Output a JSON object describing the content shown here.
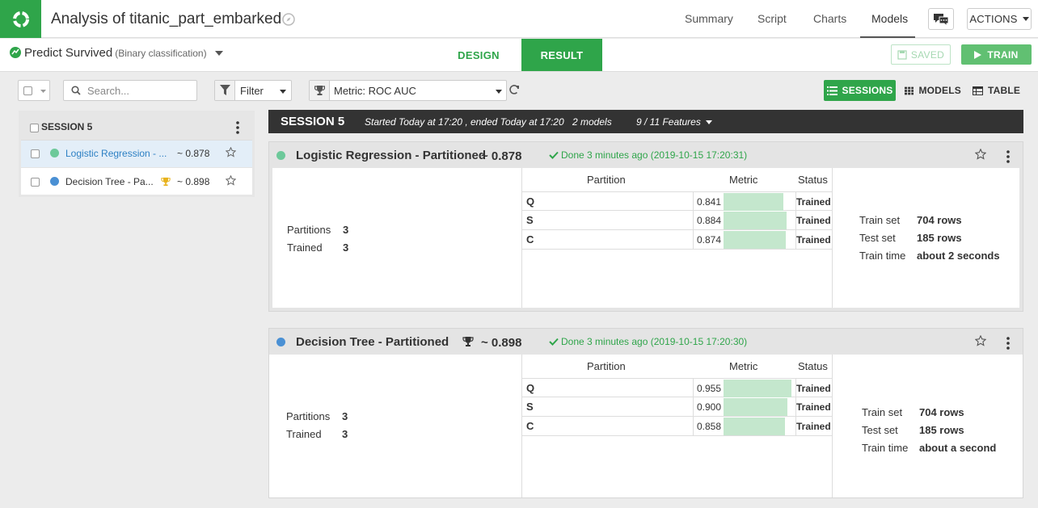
{
  "header": {
    "title": "Analysis of titanic_part_embarked",
    "nav": [
      "Summary",
      "Script",
      "Charts",
      "Models"
    ],
    "active_nav": "Models",
    "actions_label": "ACTIONS"
  },
  "subheader": {
    "task_title": "Predict Survived",
    "task_type": "(Binary classification)",
    "tabs": {
      "design": "DESIGN",
      "result": "RESULT"
    },
    "active_tab": "RESULT",
    "saved_label": "SAVED",
    "train_label": "TRAIN"
  },
  "toolbar": {
    "search_placeholder": "Search...",
    "filter_label": "Filter",
    "metric_label": "Metric: ROC AUC",
    "views": {
      "sessions": "SESSIONS",
      "models": "MODELS",
      "table": "TABLE"
    },
    "active_view": "SESSIONS"
  },
  "sidebar": {
    "session_label": "SESSION 5",
    "models": [
      {
        "name": "Logistic Regression - ...",
        "score": "~ 0.878",
        "color": "#6dc99a",
        "best": false,
        "selected": true
      },
      {
        "name": "Decision Tree - Pa...",
        "score": "~ 0.898",
        "color": "#4a90d4",
        "best": true,
        "selected": false
      }
    ]
  },
  "session": {
    "title": "SESSION 5",
    "times": "Started Today at 17:20 , ended Today at 17:20",
    "models_count": "2 models",
    "features": "9 / 11 Features"
  },
  "colors": {
    "accent": "#2fa54a",
    "metric_bar": "#c4e7cd",
    "dark_bar": "#333333"
  },
  "models": [
    {
      "name": "Logistic Regression - Partitioned",
      "score": "~ 0.878",
      "color": "#6dc99a",
      "best": false,
      "status": "Done 3 minutes ago (2019-10-15 17:20:31)",
      "partitions_label": "Partitions",
      "partitions": "3",
      "trained_label": "Trained",
      "trained": "3",
      "table_headers": {
        "partition": "Partition",
        "metric": "Metric",
        "status": "Status"
      },
      "rows": [
        {
          "partition": "Q",
          "metric": "0.841",
          "value": 0.841,
          "status": "Trained"
        },
        {
          "partition": "S",
          "metric": "0.884",
          "value": 0.884,
          "status": "Trained"
        },
        {
          "partition": "C",
          "metric": "0.874",
          "value": 0.874,
          "status": "Trained"
        }
      ],
      "stats": [
        {
          "label": "Train set",
          "value": "704 rows"
        },
        {
          "label": "Test set",
          "value": "185 rows"
        },
        {
          "label": "Train time",
          "value": "about 2 seconds"
        }
      ]
    },
    {
      "name": "Decision Tree - Partitioned",
      "score": "~ 0.898",
      "color": "#4a90d4",
      "best": true,
      "status": "Done 3 minutes ago (2019-10-15 17:20:30)",
      "partitions_label": "Partitions",
      "partitions": "3",
      "trained_label": "Trained",
      "trained": "3",
      "table_headers": {
        "partition": "Partition",
        "metric": "Metric",
        "status": "Status"
      },
      "rows": [
        {
          "partition": "Q",
          "metric": "0.955",
          "value": 0.955,
          "status": "Trained"
        },
        {
          "partition": "S",
          "metric": "0.900",
          "value": 0.9,
          "status": "Trained"
        },
        {
          "partition": "C",
          "metric": "0.858",
          "value": 0.858,
          "status": "Trained"
        }
      ],
      "stats": [
        {
          "label": "Train set",
          "value": "704 rows"
        },
        {
          "label": "Test set",
          "value": "185 rows"
        },
        {
          "label": "Train time",
          "value": "about a second"
        }
      ]
    }
  ]
}
